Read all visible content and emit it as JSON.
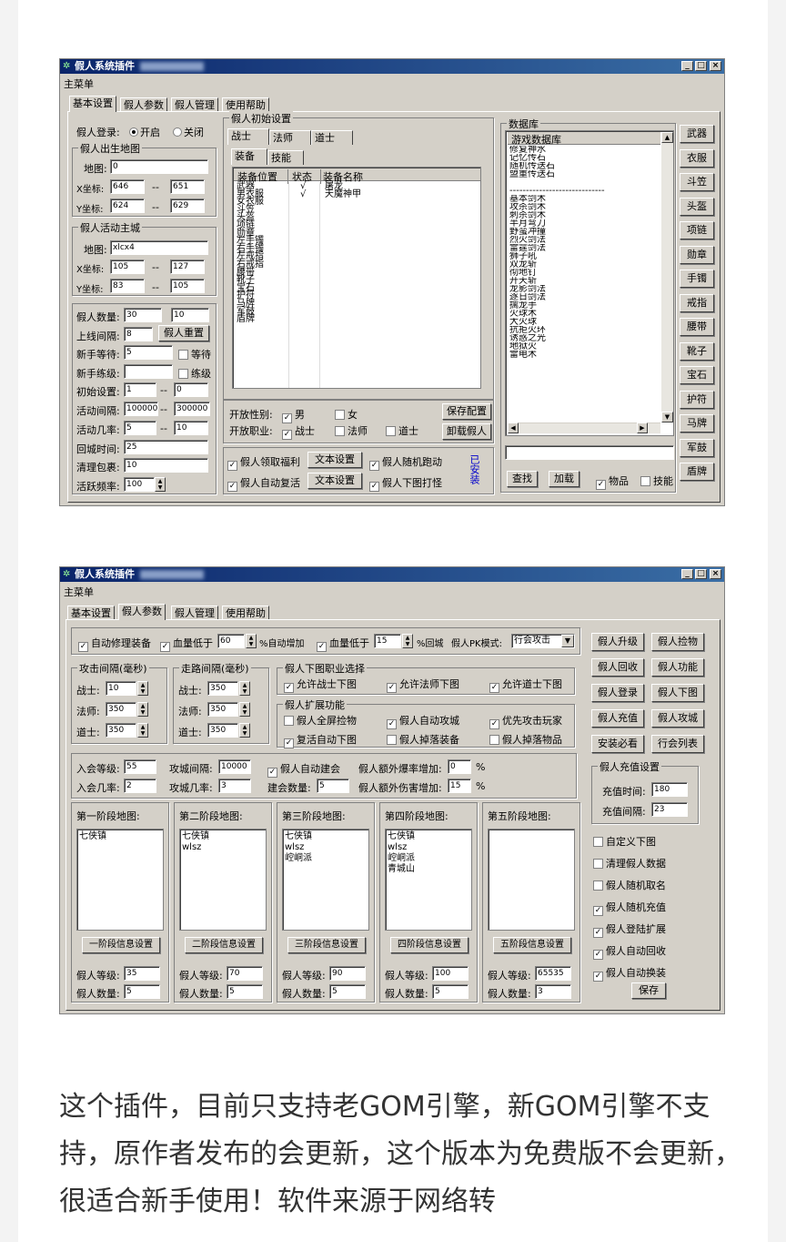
{
  "w1": {
    "title": "假人系统插件",
    "menu": "主菜单",
    "tabs": [
      "基本设置",
      "假人参数",
      "假人管理",
      "使用帮助"
    ],
    "login": {
      "label": "假人登录:",
      "on": "开启",
      "off": "关闭"
    },
    "birth": {
      "group": "假人出生地图",
      "map_label": "地图:",
      "map": "0",
      "x_label": "X坐标:",
      "x1": "646",
      "x2": "651",
      "y_label": "Y坐标:",
      "y1": "624",
      "y2": "629",
      "dash": "--"
    },
    "city": {
      "group": "假人活动主城",
      "map_label": "地图:",
      "map": "xlcx4",
      "x_label": "X坐标:",
      "x1": "105",
      "x2": "127",
      "y_label": "Y坐标:",
      "y1": "83",
      "y2": "105",
      "dash": "--"
    },
    "params": {
      "count_label": "假人数量:",
      "count1": "30",
      "count2": "10",
      "online_label": "上线间隔:",
      "online": "8",
      "reset_btn": "假人重置",
      "newwait_label": "新手等待:",
      "newwait": "5",
      "wait_cb": "等待",
      "newlvl_label": "新手练级:",
      "newlvl": "",
      "lvl_cb": "练级",
      "init_label": "初始设置:",
      "init1": "1",
      "init2": "0",
      "act_label": "活动间隔:",
      "act1": "100000",
      "act2": "300000",
      "actrate_label": "活动几率:",
      "actrate1": "5",
      "actrate2": "10",
      "return_label": "回城时间:",
      "return": "25",
      "clean_label": "清理包裹:",
      "clean": "10",
      "freq_label": "活跃频率:",
      "freq": "100"
    },
    "init": {
      "group": "假人初始设置",
      "class_tabs": [
        "战士",
        "法师",
        "道士"
      ],
      "sub_tabs": [
        "装备",
        "技能"
      ],
      "cols": [
        "装备位置",
        "状态",
        "装备名称"
      ],
      "rows": [
        {
          "pos": "武器",
          "st": "√",
          "name": "屠龙"
        },
        {
          "pos": "男衣服",
          "st": "√",
          "name": "天魔神甲"
        },
        {
          "pos": "女衣服",
          "st": "",
          "name": ""
        },
        {
          "pos": "斗笠",
          "st": "",
          "name": ""
        },
        {
          "pos": "头盔",
          "st": "",
          "name": ""
        },
        {
          "pos": "项链",
          "st": "",
          "name": ""
        },
        {
          "pos": "勋章",
          "st": "",
          "name": ""
        },
        {
          "pos": "左手镯",
          "st": "",
          "name": ""
        },
        {
          "pos": "右手镯",
          "st": "",
          "name": ""
        },
        {
          "pos": "左戒指",
          "st": "",
          "name": ""
        },
        {
          "pos": "右戒指",
          "st": "",
          "name": ""
        },
        {
          "pos": "腰带",
          "st": "",
          "name": ""
        },
        {
          "pos": "靴子",
          "st": "",
          "name": ""
        },
        {
          "pos": "宝石",
          "st": "",
          "name": ""
        },
        {
          "pos": "护符",
          "st": "",
          "name": ""
        },
        {
          "pos": "马牌",
          "st": "",
          "name": ""
        },
        {
          "pos": "军鼓",
          "st": "",
          "name": ""
        },
        {
          "pos": "盾牌",
          "st": "",
          "name": ""
        }
      ]
    },
    "open": {
      "gender_label": "开放性别:",
      "male": "男",
      "female": "女",
      "job_label": "开放职业:",
      "jobs": [
        "战士",
        "法师",
        "道士"
      ],
      "save_btn": "保存配置",
      "unload_btn": "卸载假人"
    },
    "bottom": {
      "welfare": "假人领取福利",
      "text_btn": "文本设置",
      "run": "假人随机跑动",
      "revive": "假人自动复活",
      "fight": "假人下图打怪",
      "installed": "已安装"
    },
    "db": {
      "group": "数据库",
      "header": "游戏数据库",
      "items": [
        "修复神水",
        "记忆传石",
        "随机传送石",
        "盟重传送石",
        "",
        "-----------------------------",
        "基本剑术",
        "攻杀剑术",
        "刺杀剑术",
        "半月弯刀",
        "野蛮冲撞",
        "烈火剑法",
        "雷霆剑法",
        "狮子吼",
        "双龙斩",
        "彻地钉",
        "开天斩",
        "龙影剑法",
        "逐日剑法",
        "擒龙手",
        "火球术",
        "大火球",
        "抗拒火环",
        "诱惑之光",
        "地狱火",
        "雷电术"
      ],
      "btns": [
        "武器",
        "衣服",
        "斗笠",
        "头盔",
        "项链",
        "勋章",
        "手镯",
        "戒指",
        "腰带",
        "靴子",
        "宝石",
        "护符",
        "马牌",
        "军鼓",
        "盾牌"
      ],
      "find": "查找",
      "load": "加载",
      "item_cb": "物品",
      "skill_cb": "技能"
    }
  },
  "w2": {
    "title": "假人系统插件",
    "menu": "主菜单",
    "tabs": [
      "基本设置",
      "假人参数",
      "假人管理",
      "使用帮助"
    ],
    "top": {
      "repair": "自动修理装备",
      "hp_low": "血量低于",
      "hp1": "60",
      "auto_add": "%自动增加",
      "hp_low2": "血量低于",
      "hp2": "15",
      "back": "%回城",
      "pk_label": "假人PK模式:",
      "pk": "行会攻击"
    },
    "atk": {
      "group": "攻击间隔(毫秒)",
      "warrior": "战士:",
      "w": "10",
      "mage": "法师:",
      "m": "350",
      "taoist": "道士:",
      "t": "350"
    },
    "walk": {
      "group": "走路间隔(毫秒)",
      "warrior": "战士:",
      "w": "350",
      "mage": "法师:",
      "m": "350",
      "taoist": "道士:",
      "t": "350"
    },
    "job": {
      "group": "假人下图职业选择",
      "opts": [
        "允许战士下图",
        "允许法师下图",
        "允许道士下图"
      ]
    },
    "ext": {
      "group": "假人扩展功能",
      "opts": [
        "假人全屏捡物",
        "假人自动攻城",
        "优先攻击玩家",
        "复活自动下图",
        "假人掉落装备",
        "假人掉落物品"
      ]
    },
    "guild": {
      "lvl_label": "入会等级:",
      "lvl": "55",
      "rate_label": "入会几率:",
      "rate": "2",
      "siege_label": "攻城间隔:",
      "siege": "10000",
      "siege_rate_label": "攻城几率:",
      "siege_rate": "3",
      "auto_guild": "假人自动建会",
      "guild_count_label": "建会数量:",
      "guild_count": "5",
      "burst_label": "假人额外爆率增加:",
      "burst": "0",
      "dmg_label": "假人额外伤害增加:",
      "dmg": "15",
      "pct": "%"
    },
    "stages": [
      {
        "title": "第一阶段地图:",
        "maps": [
          "七侠镇"
        ],
        "btn": "一阶段信息设置",
        "lvl": "35",
        "cnt": "5"
      },
      {
        "title": "第二阶段地图:",
        "maps": [
          "七侠镇",
          "wlsz"
        ],
        "btn": "二阶段信息设置",
        "lvl": "70",
        "cnt": "5"
      },
      {
        "title": "第三阶段地图:",
        "maps": [
          "七侠镇",
          "wlsz",
          "崆峒派"
        ],
        "btn": "三阶段信息设置",
        "lvl": "90",
        "cnt": "5"
      },
      {
        "title": "第四阶段地图:",
        "maps": [
          "七侠镇",
          "wlsz",
          "崆峒派",
          "青城山"
        ],
        "btn": "四阶段信息设置",
        "lvl": "100",
        "cnt": "5"
      },
      {
        "title": "第五阶段地图:",
        "maps": [],
        "btn": "五阶段信息设置",
        "lvl": "65535",
        "cnt": "3"
      }
    ],
    "lvl_label": "假人等级:",
    "cnt_label": "假人数量:",
    "side_btns": [
      "假人升级",
      "假人捡物",
      "假人回收",
      "假人功能",
      "假人登录",
      "假人下图",
      "假人充值",
      "假人攻城",
      "安装必看",
      "行会列表"
    ],
    "recharge": {
      "group": "假人充值设置",
      "time_label": "充值时间:",
      "time": "180",
      "int_label": "充值间隔:",
      "int": "23"
    },
    "checks": [
      {
        "label": "自定义下图",
        "on": false
      },
      {
        "label": "清理假人数据",
        "on": false
      },
      {
        "label": "假人随机取名",
        "on": false
      },
      {
        "label": "假人随机充值",
        "on": true
      },
      {
        "label": "假人登陆扩展",
        "on": true
      },
      {
        "label": "假人自动回收",
        "on": true
      },
      {
        "label": "假人自动换装",
        "on": true
      }
    ],
    "save": "保存"
  },
  "article": "这个插件，目前只支持老GOM引擎，新GOM引擎不支持，原作者发布的会更新，这个版本为免费版不会更新，很适合新手使用！软件来源于网络转"
}
